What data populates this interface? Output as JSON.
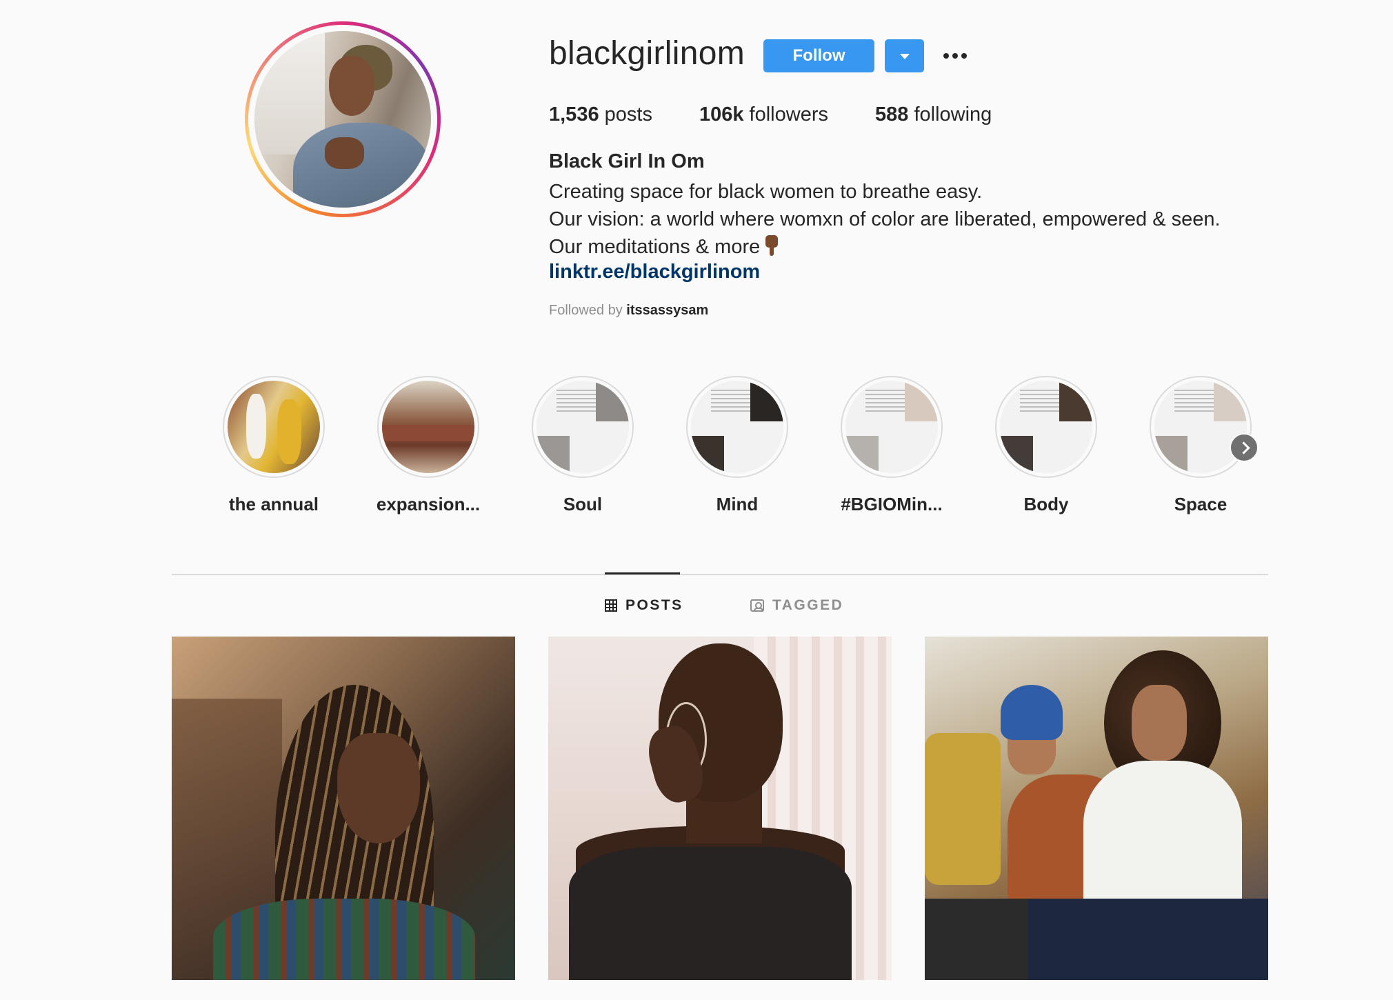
{
  "profile": {
    "username": "blackgirlinom",
    "follow_label": "Follow",
    "stats": {
      "posts_count": "1,536",
      "posts_label": "posts",
      "followers_count": "106k",
      "followers_label": "followers",
      "following_count": "588",
      "following_label": "following"
    },
    "full_name": "Black Girl In Om",
    "bio_lines": [
      "Creating space for black women to breathe easy.",
      "Our vision: a world where womxn of color are liberated, empowered & seen.",
      "Our meditations & more"
    ],
    "link": "linktr.ee/blackgirlinom",
    "followed_by_label": "Followed by",
    "followed_by_user": "itssassysam"
  },
  "highlights": [
    {
      "label": "the annual"
    },
    {
      "label": "expansion..."
    },
    {
      "label": "Soul"
    },
    {
      "label": "Mind"
    },
    {
      "label": "#BGIOMin..."
    },
    {
      "label": "Body"
    },
    {
      "label": "Space"
    }
  ],
  "tabs": {
    "posts": "POSTS",
    "tagged": "TAGGED"
  },
  "colors": {
    "primary_button": "#3897f0",
    "link": "#003569",
    "muted_text": "#8e8e8e"
  }
}
